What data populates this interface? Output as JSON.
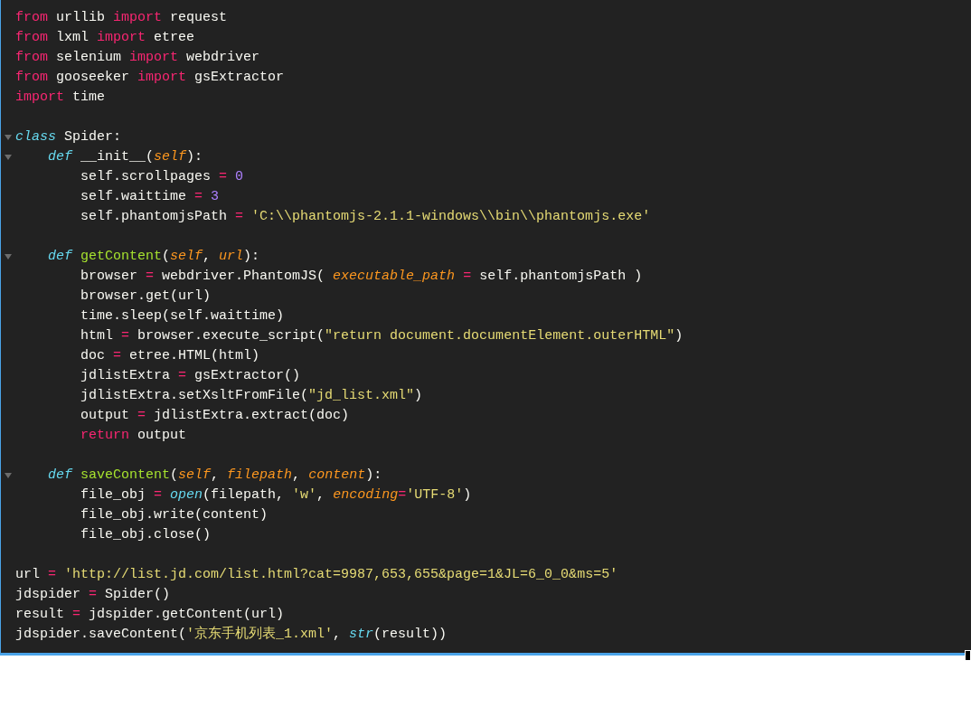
{
  "editor": {
    "lines": [
      {
        "foldable": false,
        "tokens": [
          {
            "kind": "keyword",
            "text": "from"
          },
          {
            "kind": "plain",
            "text": " urllib "
          },
          {
            "kind": "keyword",
            "text": "import"
          },
          {
            "kind": "plain",
            "text": " request"
          }
        ]
      },
      {
        "foldable": false,
        "tokens": [
          {
            "kind": "keyword",
            "text": "from"
          },
          {
            "kind": "plain",
            "text": " lxml "
          },
          {
            "kind": "keyword",
            "text": "import"
          },
          {
            "kind": "plain",
            "text": " etree"
          }
        ]
      },
      {
        "foldable": false,
        "tokens": [
          {
            "kind": "keyword",
            "text": "from"
          },
          {
            "kind": "plain",
            "text": " selenium "
          },
          {
            "kind": "keyword",
            "text": "import"
          },
          {
            "kind": "plain",
            "text": " webdriver"
          }
        ]
      },
      {
        "foldable": false,
        "tokens": [
          {
            "kind": "keyword",
            "text": "from"
          },
          {
            "kind": "plain",
            "text": " gooseeker "
          },
          {
            "kind": "keyword",
            "text": "import"
          },
          {
            "kind": "plain",
            "text": " gsExtractor"
          }
        ]
      },
      {
        "foldable": false,
        "tokens": [
          {
            "kind": "keyword",
            "text": "import"
          },
          {
            "kind": "plain",
            "text": " time"
          }
        ]
      },
      {
        "foldable": false
      },
      {
        "foldable": true,
        "tokens": [
          {
            "kind": "storage",
            "text": "class"
          },
          {
            "kind": "plain",
            "text": " Spider:"
          }
        ]
      },
      {
        "foldable": true,
        "tokens": [
          {
            "kind": "storage",
            "text": "    def"
          },
          {
            "kind": "plain",
            "text": " __init__("
          },
          {
            "kind": "param",
            "text": "self"
          },
          {
            "kind": "plain",
            "text": "):"
          }
        ]
      },
      {
        "foldable": false,
        "tokens": [
          {
            "kind": "plain",
            "text": "        self.scrollpages "
          },
          {
            "kind": "keyword",
            "text": "="
          },
          {
            "kind": "number",
            "text": " 0"
          }
        ]
      },
      {
        "foldable": false,
        "tokens": [
          {
            "kind": "plain",
            "text": "        self.waittime "
          },
          {
            "kind": "keyword",
            "text": "="
          },
          {
            "kind": "number",
            "text": " 3"
          }
        ]
      },
      {
        "foldable": false,
        "tokens": [
          {
            "kind": "plain",
            "text": "        self.phantomjsPath "
          },
          {
            "kind": "keyword",
            "text": "="
          },
          {
            "kind": "string",
            "text": " 'C:\\\\phantomjs-2.1.1-windows\\\\bin\\\\phantomjs.exe'"
          }
        ]
      },
      {
        "foldable": false
      },
      {
        "foldable": true,
        "tokens": [
          {
            "kind": "storage",
            "text": "    def"
          },
          {
            "kind": "function",
            "text": " getContent"
          },
          {
            "kind": "plain",
            "text": "("
          },
          {
            "kind": "param",
            "text": "self"
          },
          {
            "kind": "plain",
            "text": ", "
          },
          {
            "kind": "param",
            "text": "url"
          },
          {
            "kind": "plain",
            "text": "):"
          }
        ]
      },
      {
        "foldable": false,
        "tokens": [
          {
            "kind": "plain",
            "text": "        browser "
          },
          {
            "kind": "keyword",
            "text": "="
          },
          {
            "kind": "plain",
            "text": " webdriver.PhantomJS( "
          },
          {
            "kind": "param",
            "text": "executable_path"
          },
          {
            "kind": "keyword",
            "text": " ="
          },
          {
            "kind": "plain",
            "text": " self.phantomjsPath )"
          }
        ]
      },
      {
        "foldable": false,
        "tokens": [
          {
            "kind": "plain",
            "text": "        browser.get(url)"
          }
        ]
      },
      {
        "foldable": false,
        "tokens": [
          {
            "kind": "plain",
            "text": "        time.sleep(self.waittime)"
          }
        ]
      },
      {
        "foldable": false,
        "tokens": [
          {
            "kind": "plain",
            "text": "        html "
          },
          {
            "kind": "keyword",
            "text": "="
          },
          {
            "kind": "plain",
            "text": " browser.execute_script("
          },
          {
            "kind": "string",
            "text": "\"return document.documentElement.outerHTML\""
          },
          {
            "kind": "plain",
            "text": ")"
          }
        ]
      },
      {
        "foldable": false,
        "tokens": [
          {
            "kind": "plain",
            "text": "        doc "
          },
          {
            "kind": "keyword",
            "text": "="
          },
          {
            "kind": "plain",
            "text": " etree.HTML(html)"
          }
        ]
      },
      {
        "foldable": false,
        "tokens": [
          {
            "kind": "plain",
            "text": "        jdlistExtra "
          },
          {
            "kind": "keyword",
            "text": "="
          },
          {
            "kind": "plain",
            "text": " gsExtractor()"
          }
        ]
      },
      {
        "foldable": false,
        "tokens": [
          {
            "kind": "plain",
            "text": "        jdlistExtra.setXsltFromFile("
          },
          {
            "kind": "string",
            "text": "\"jd_list.xml\""
          },
          {
            "kind": "plain",
            "text": ")"
          }
        ]
      },
      {
        "foldable": false,
        "tokens": [
          {
            "kind": "plain",
            "text": "        output "
          },
          {
            "kind": "keyword",
            "text": "="
          },
          {
            "kind": "plain",
            "text": " jdlistExtra.extract(doc)"
          }
        ]
      },
      {
        "foldable": false,
        "tokens": [
          {
            "kind": "keyword",
            "text": "        return"
          },
          {
            "kind": "plain",
            "text": " output"
          }
        ]
      },
      {
        "foldable": false
      },
      {
        "foldable": true,
        "tokens": [
          {
            "kind": "storage",
            "text": "    def"
          },
          {
            "kind": "function",
            "text": " saveContent"
          },
          {
            "kind": "plain",
            "text": "("
          },
          {
            "kind": "param",
            "text": "self"
          },
          {
            "kind": "plain",
            "text": ", "
          },
          {
            "kind": "param",
            "text": "filepath"
          },
          {
            "kind": "plain",
            "text": ", "
          },
          {
            "kind": "param",
            "text": "content"
          },
          {
            "kind": "plain",
            "text": "):"
          }
        ]
      },
      {
        "foldable": false,
        "tokens": [
          {
            "kind": "plain",
            "text": "        file_obj "
          },
          {
            "kind": "keyword",
            "text": "="
          },
          {
            "kind": "builtin",
            "text": " open"
          },
          {
            "kind": "plain",
            "text": "(filepath, "
          },
          {
            "kind": "string",
            "text": "'w'"
          },
          {
            "kind": "plain",
            "text": ", "
          },
          {
            "kind": "param",
            "text": "encoding"
          },
          {
            "kind": "keyword",
            "text": "="
          },
          {
            "kind": "string",
            "text": "'UTF-8'"
          },
          {
            "kind": "plain",
            "text": ")"
          }
        ]
      },
      {
        "foldable": false,
        "tokens": [
          {
            "kind": "plain",
            "text": "        file_obj.write(content)"
          }
        ]
      },
      {
        "foldable": false,
        "tokens": [
          {
            "kind": "plain",
            "text": "        file_obj.close()"
          }
        ]
      },
      {
        "foldable": false
      },
      {
        "foldable": false,
        "tokens": [
          {
            "kind": "plain",
            "text": "url "
          },
          {
            "kind": "keyword",
            "text": "="
          },
          {
            "kind": "string",
            "text": " 'http://list.jd.com/list.html?cat=9987,653,655&page=1&JL=6_0_0&ms=5'"
          }
        ]
      },
      {
        "foldable": false,
        "tokens": [
          {
            "kind": "plain",
            "text": "jdspider "
          },
          {
            "kind": "keyword",
            "text": "="
          },
          {
            "kind": "plain",
            "text": " Spider()"
          }
        ]
      },
      {
        "foldable": false,
        "tokens": [
          {
            "kind": "plain",
            "text": "result "
          },
          {
            "kind": "keyword",
            "text": "="
          },
          {
            "kind": "plain",
            "text": " jdspider.getContent(url)"
          }
        ]
      },
      {
        "foldable": false,
        "tokens": [
          {
            "kind": "plain",
            "text": "jdspider.saveContent("
          },
          {
            "kind": "string",
            "text": "'京东手机列表_1.xml'"
          },
          {
            "kind": "plain",
            "text": ", "
          },
          {
            "kind": "builtin",
            "text": "str"
          },
          {
            "kind": "plain",
            "text": "(result))"
          }
        ]
      }
    ]
  }
}
